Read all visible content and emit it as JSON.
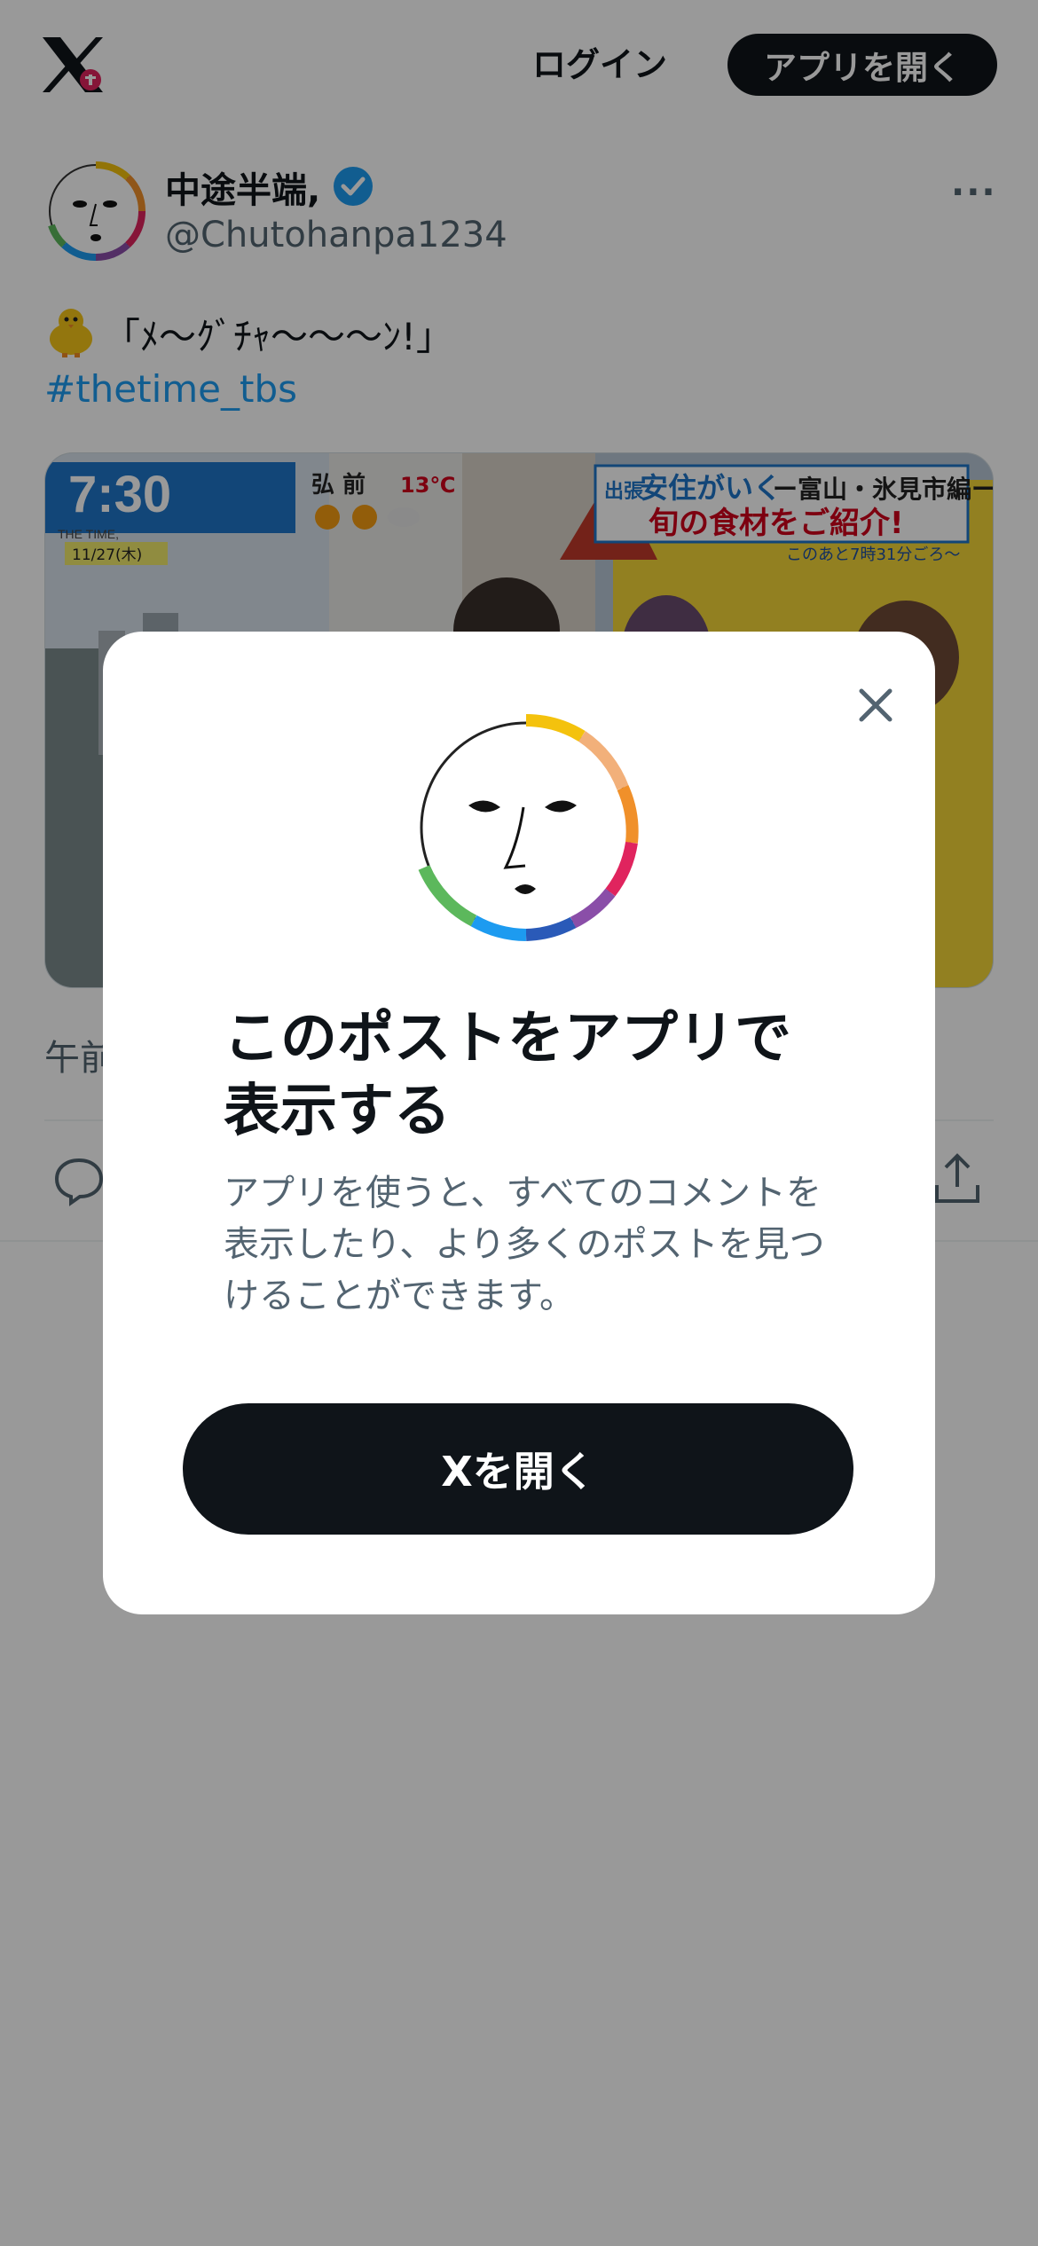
{
  "header": {
    "login_label": "ログイン",
    "open_app_label": "アプリを開く"
  },
  "tweet": {
    "user_name": "中途半端,",
    "handle": "@Chutohanpa1234",
    "text": "「ﾒ～ｸﾞﾁｬ～～～ﾝ!」",
    "hashtag": "#thetime_tbs",
    "timestamp": "午前",
    "more_label": "···",
    "media": {
      "logo_small": "THE TIME,",
      "clock": "7:30",
      "date": "11/27(木)",
      "city": "弘 前",
      "temperature": "13℃",
      "banner_tag": "出張",
      "banner_title": "安住がいく",
      "banner_location": "ー富山・氷見市編ー",
      "banner_sub": "旬の食材をご紹介!",
      "banner_note": "このあと7時31分ごろ〜"
    }
  },
  "modal": {
    "title": "このポストをアプリで表示する",
    "description": "アプリを使うと、すべてのコメントを表示したり、より多くのポストを見つけることができます。",
    "button_label": "Xを開く"
  },
  "colors": {
    "brand_dark": "#0f1419",
    "link_blue": "#1d9bf0",
    "secondary_text": "#536471",
    "overlay": "rgba(0,0,0,0.4)"
  }
}
